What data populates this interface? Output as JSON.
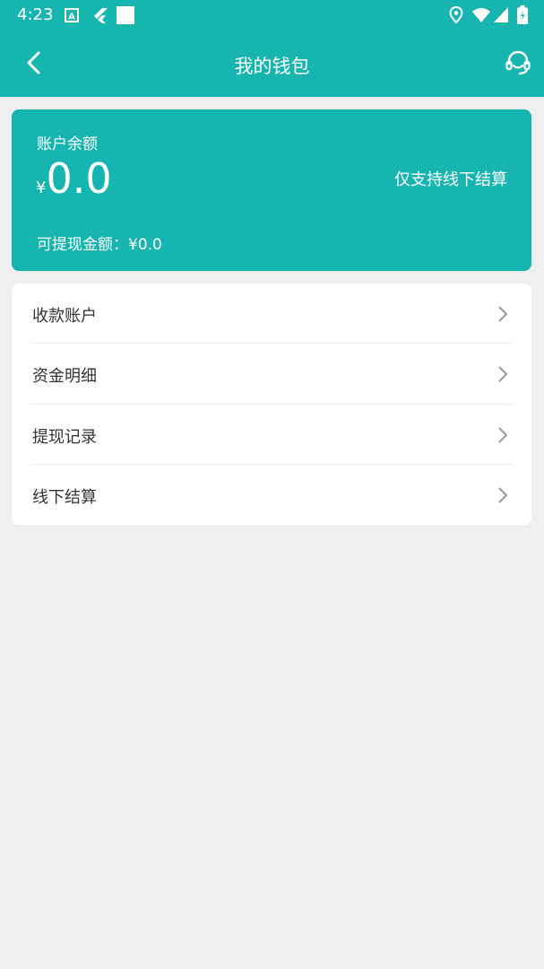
{
  "status_bar": {
    "time": "4:23",
    "icons": [
      "a-box-icon",
      "flutter-icon",
      "white-square-icon",
      "location-icon",
      "wifi-icon",
      "signal-icon",
      "battery-icon"
    ]
  },
  "header": {
    "title": "我的钱包",
    "back_icon": "back-arrow-icon",
    "service_icon": "headset-icon"
  },
  "balance": {
    "label": "账户余额",
    "currency": "¥",
    "amount": "0.0",
    "note": "仅支持线下结算",
    "withdrawable": "可提现金额：¥0.0"
  },
  "menu": {
    "items": [
      {
        "label": "收款账户"
      },
      {
        "label": "资金明细"
      },
      {
        "label": "提现记录"
      },
      {
        "label": "线下结算"
      }
    ]
  },
  "colors": {
    "primary": "#17b5b0",
    "background": "#efefef",
    "card": "#ffffff",
    "text": "#333333",
    "chevron": "#999999"
  }
}
